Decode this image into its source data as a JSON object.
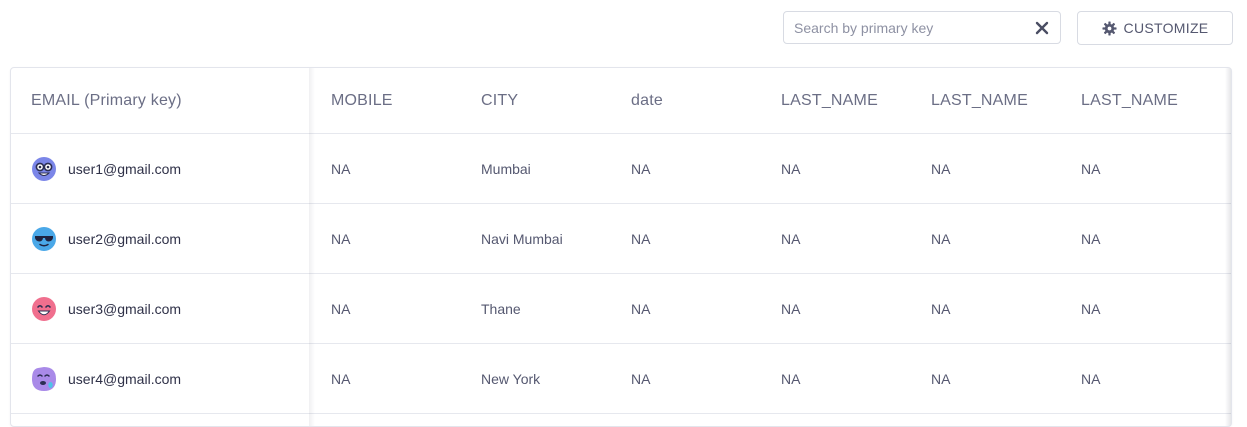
{
  "toolbar": {
    "search": {
      "placeholder": "Search by primary key",
      "value": ""
    },
    "clear_icon": "close-x-icon",
    "customize": {
      "label": "CUSTOMIZE",
      "icon": "gear-icon"
    }
  },
  "table": {
    "columns": [
      "EMAIL (Primary key)",
      "MOBILE",
      "CITY",
      "date",
      "LAST_NAME",
      "LAST_NAME",
      "LAST_NAME"
    ],
    "rows": [
      {
        "email": "user1@gmail.com",
        "avatar": "nerd-face-avatar",
        "mobile": "NA",
        "city": "Mumbai",
        "date": "NA",
        "last_name_1": "NA",
        "last_name_2": "NA",
        "last_name_3": "NA"
      },
      {
        "email": "user2@gmail.com",
        "avatar": "sunglasses-face-avatar",
        "mobile": "NA",
        "city": "Navi Mumbai",
        "date": "NA",
        "last_name_1": "NA",
        "last_name_2": "NA",
        "last_name_3": "NA"
      },
      {
        "email": "user3@gmail.com",
        "avatar": "grinning-face-avatar",
        "mobile": "NA",
        "city": "Thane",
        "date": "NA",
        "last_name_1": "NA",
        "last_name_2": "NA",
        "last_name_3": "NA"
      },
      {
        "email": "user4@gmail.com",
        "avatar": "drooling-face-avatar",
        "mobile": "NA",
        "city": "New York",
        "date": "NA",
        "last_name_1": "NA",
        "last_name_2": "NA",
        "last_name_3": "NA"
      }
    ]
  },
  "colors": {
    "border": "#d8dbe3",
    "header_text": "#6b6e85",
    "body_text": "#555870",
    "cut_mark": "#e06c5a"
  }
}
